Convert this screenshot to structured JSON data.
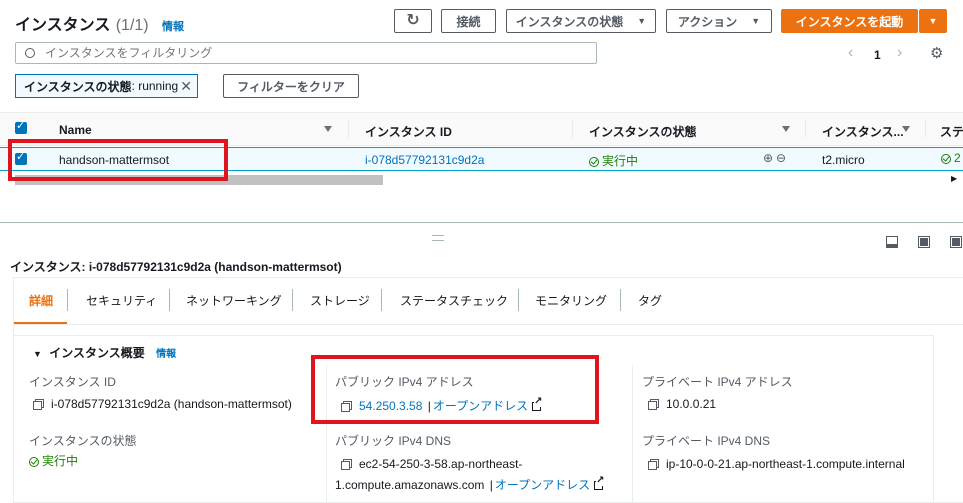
{
  "header": {
    "title": "インスタンス",
    "count": "(1/1)",
    "info": "情報",
    "connect_label": "接続",
    "state_label": "インスタンスの状態",
    "actions_label": "アクション",
    "launch_label": "インスタンスを起動"
  },
  "search": {
    "placeholder": "インスタンスをフィルタリング"
  },
  "pagination": {
    "page": "1"
  },
  "filter": {
    "token_key": "インスタンスの状態",
    "token_value": ": running",
    "clear_label": "フィルターをクリア"
  },
  "table": {
    "headers": [
      "Name",
      "インスタンス ID",
      "インスタンスの状態",
      "インスタンス...",
      "ステ"
    ],
    "row": {
      "name": "handson-mattermsot",
      "instance_id": "i-078d57792131c9d2a",
      "state": "実行中",
      "type": "t2.micro",
      "status": "2"
    }
  },
  "details": {
    "title": "インスタンス: i-078d57792131c9d2a (handson-mattermsot)",
    "tabs": [
      "詳細",
      "セキュリティ",
      "ネットワーキング",
      "ストレージ",
      "ステータスチェック",
      "モニタリング",
      "タグ"
    ],
    "summary_label": "インスタンス概要",
    "summary_info": "情報",
    "instance_id_label": "インスタンス ID",
    "instance_id_value": "i-078d57792131c9d2a (handson-mattermsot)",
    "public_ipv4_label": "パブリック IPv4 アドレス",
    "public_ipv4_value": "54.250.3.58",
    "open_address": "オープンアドレス",
    "private_ipv4_label": "プライベート IPv4 アドレス",
    "private_ipv4_value": "10.0.0.21",
    "state_label": "インスタンスの状態",
    "state_value": "実行中",
    "public_dns_label": "パブリック IPv4 DNS",
    "public_dns_line1": "ec2-54-250-3-58.ap-northeast-",
    "public_dns_line2": "1.compute.amazonaws.com",
    "private_dns_label": "プライベート IPv4 DNS",
    "private_dns_value": "ip-10-0-0-21.ap-northeast-1.compute.internal",
    "separator": "|"
  },
  "colors": {
    "accent": "#ec7211",
    "link": "#0073bb",
    "running": "#1d8102",
    "highlight": "#e0141e"
  }
}
